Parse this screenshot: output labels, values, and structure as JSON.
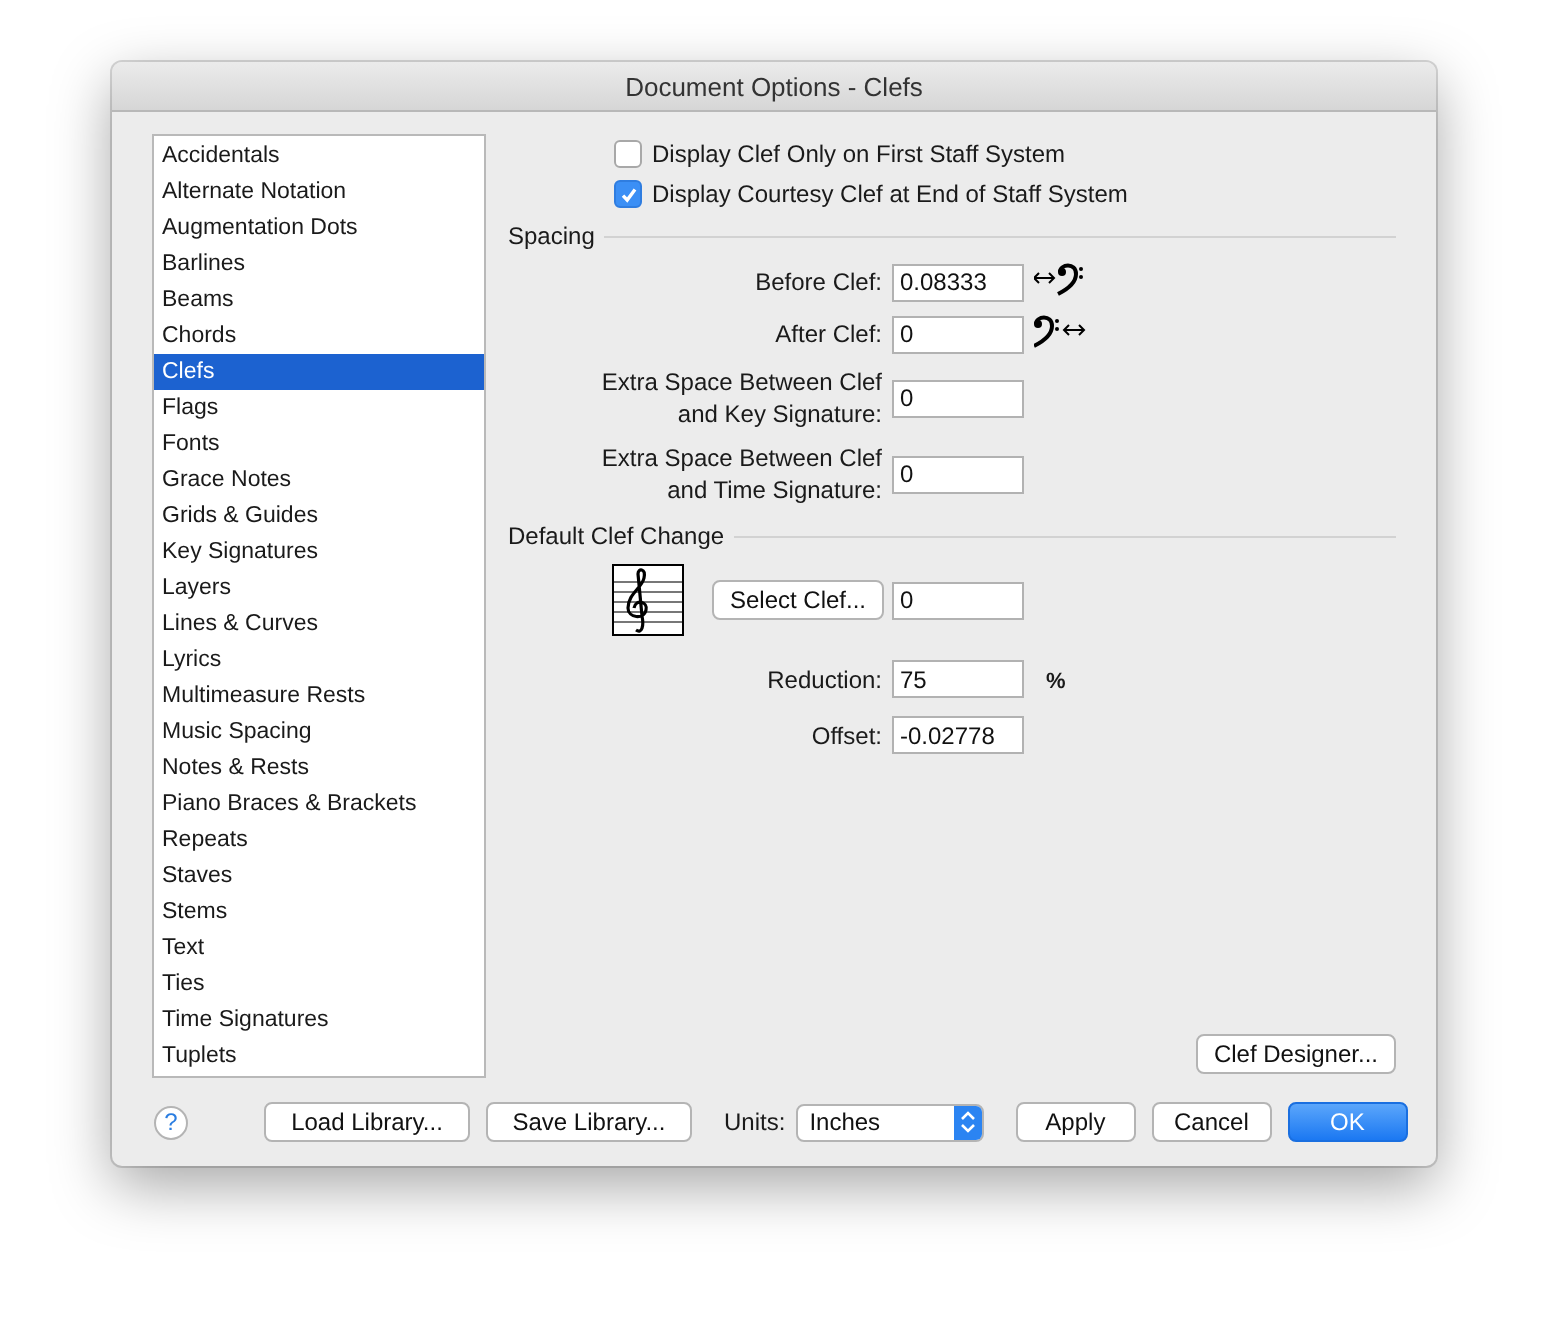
{
  "window": {
    "title": "Document Options - Clefs"
  },
  "sidebar": {
    "items": [
      {
        "label": "Accidentals",
        "selected": false
      },
      {
        "label": "Alternate Notation",
        "selected": false
      },
      {
        "label": "Augmentation Dots",
        "selected": false
      },
      {
        "label": "Barlines",
        "selected": false
      },
      {
        "label": "Beams",
        "selected": false
      },
      {
        "label": "Chords",
        "selected": false
      },
      {
        "label": "Clefs",
        "selected": true
      },
      {
        "label": "Flags",
        "selected": false
      },
      {
        "label": "Fonts",
        "selected": false
      },
      {
        "label": "Grace Notes",
        "selected": false
      },
      {
        "label": "Grids & Guides",
        "selected": false
      },
      {
        "label": "Key Signatures",
        "selected": false
      },
      {
        "label": "Layers",
        "selected": false
      },
      {
        "label": "Lines & Curves",
        "selected": false
      },
      {
        "label": "Lyrics",
        "selected": false
      },
      {
        "label": "Multimeasure Rests",
        "selected": false
      },
      {
        "label": "Music Spacing",
        "selected": false
      },
      {
        "label": "Notes & Rests",
        "selected": false
      },
      {
        "label": "Piano Braces & Brackets",
        "selected": false
      },
      {
        "label": "Repeats",
        "selected": false
      },
      {
        "label": "Staves",
        "selected": false
      },
      {
        "label": "Stems",
        "selected": false
      },
      {
        "label": "Text",
        "selected": false
      },
      {
        "label": "Ties",
        "selected": false
      },
      {
        "label": "Time Signatures",
        "selected": false
      },
      {
        "label": "Tuplets",
        "selected": false
      }
    ]
  },
  "options": [
    {
      "label": "Display Clef Only on First Staff System",
      "checked": false
    },
    {
      "label": "Display Courtesy Clef at End of Staff System",
      "checked": true
    }
  ],
  "spacing": {
    "title": "Spacing",
    "rows": [
      {
        "kind": "before",
        "label": [
          "Before Clef:"
        ],
        "value": "0.08333"
      },
      {
        "kind": "after",
        "label": [
          "After Clef:"
        ],
        "value": "0"
      },
      {
        "kind": "plain",
        "label": [
          "Extra Space Between Clef",
          "and Key Signature:"
        ],
        "value": "0"
      },
      {
        "kind": "plain",
        "label": [
          "Extra Space Between Clef",
          "and Time Signature:"
        ],
        "value": "0"
      }
    ]
  },
  "default_clef_change": {
    "title": "Default Clef Change",
    "select_button": "Select Clef...",
    "clef_value": "0",
    "rows": [
      {
        "label": "Reduction:",
        "value": "75",
        "unit": "%"
      },
      {
        "label": "Offset:",
        "value": "-0.02778"
      }
    ]
  },
  "clef_designer_button": "Clef Designer...",
  "footer": {
    "help": "?",
    "buttons_left": [
      "Load Library...",
      "Save Library..."
    ],
    "units": {
      "label": "Units:",
      "value": "Inches"
    },
    "buttons_right": [
      {
        "label": "Apply",
        "default": false
      },
      {
        "label": "Cancel",
        "default": false
      },
      {
        "label": "OK",
        "default": true
      }
    ]
  }
}
